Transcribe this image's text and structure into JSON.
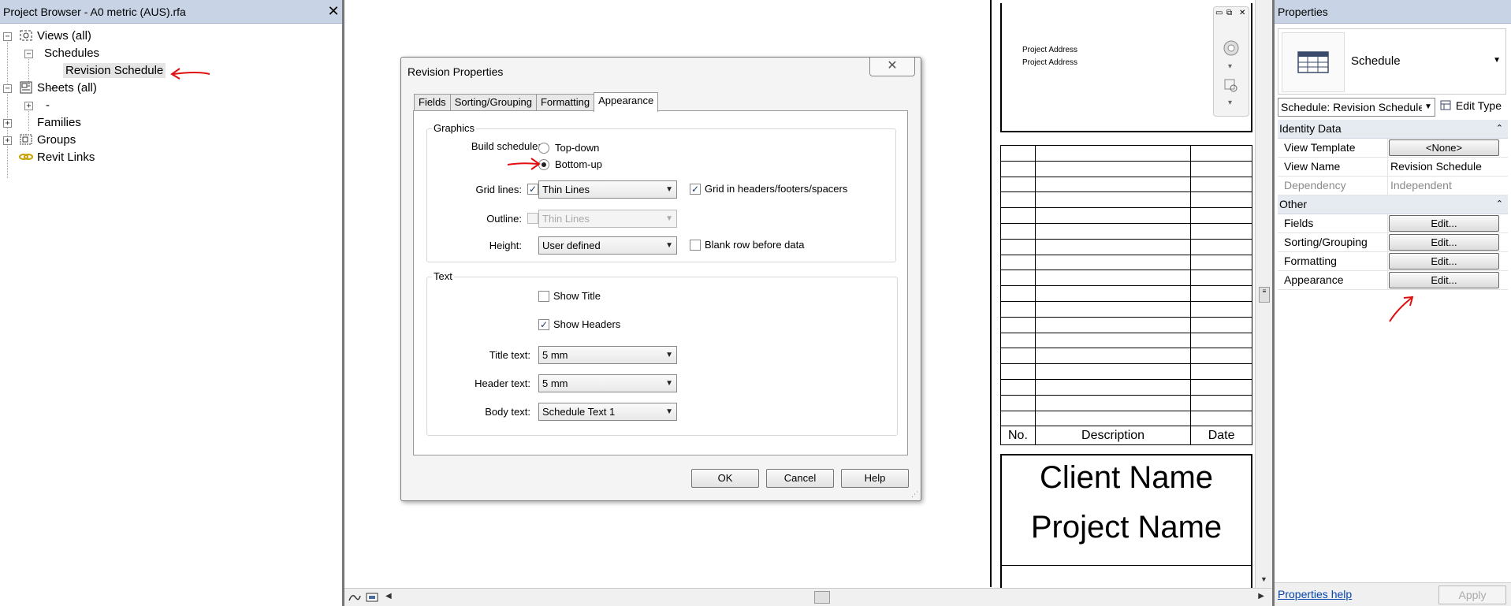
{
  "project_browser": {
    "title": "Project Browser - A0 metric (AUS).rfa",
    "close": "✕",
    "nodes": {
      "views": "Views (all)",
      "schedules": "Schedules",
      "revision_schedule": "Revision Schedule",
      "sheets": "Sheets (all)",
      "sheet_child": "-",
      "families": "Families",
      "groups": "Groups",
      "revit_links": "Revit Links"
    }
  },
  "titleblock": {
    "address_line1": "Project Address",
    "address_line2": "Project Address",
    "table_headers": [
      "No.",
      "Description",
      "Date"
    ],
    "client_name": "Client Name",
    "project_name": "Project Name"
  },
  "dialog": {
    "title": "Revision Properties",
    "close": "✕",
    "tabs": [
      "Fields",
      "Sorting/Grouping",
      "Formatting",
      "Appearance"
    ],
    "active_tab": "Appearance",
    "graphics": {
      "group_label": "Graphics",
      "build_schedule_label": "Build schedule:",
      "top_down": "Top-down",
      "bottom_up": "Bottom-up",
      "selected": "Bottom-up",
      "grid_lines_label": "Grid lines:",
      "grid_lines_checked": true,
      "grid_lines_value": "Thin Lines",
      "grid_in_headers": "Grid in headers/footers/spacers",
      "grid_in_headers_checked": true,
      "outline_label": "Outline:",
      "outline_checked": false,
      "outline_value": "Thin Lines",
      "height_label": "Height:",
      "height_value": "User defined",
      "blank_row": "Blank row before data",
      "blank_row_checked": false
    },
    "text": {
      "group_label": "Text",
      "show_title": "Show Title",
      "show_title_checked": false,
      "show_headers": "Show Headers",
      "show_headers_checked": true,
      "title_text_label": "Title text:",
      "title_text_value": "5 mm",
      "header_text_label": "Header text:",
      "header_text_value": "5 mm",
      "body_text_label": "Body text:",
      "body_text_value": "Schedule Text 1"
    },
    "buttons": {
      "ok": "OK",
      "cancel": "Cancel",
      "help": "Help"
    }
  },
  "properties": {
    "title": "Properties",
    "type_name": "Schedule",
    "selector": "Schedule: Revision Schedule",
    "edit_type": "Edit Type",
    "sections": {
      "identity": "Identity Data",
      "other": "Other"
    },
    "identity_rows": [
      {
        "name": "View Template",
        "value": "<None>",
        "button": true
      },
      {
        "name": "View Name",
        "value": "Revision Schedule",
        "button": false
      },
      {
        "name": "Dependency",
        "value": "Independent",
        "button": false
      }
    ],
    "other_rows": [
      {
        "name": "Fields",
        "value": "Edit..."
      },
      {
        "name": "Sorting/Grouping",
        "value": "Edit..."
      },
      {
        "name": "Formatting",
        "value": "Edit..."
      },
      {
        "name": "Appearance",
        "value": "Edit..."
      }
    ],
    "help_link": "Properties help",
    "apply": "Apply"
  },
  "colors": {
    "panel_title_bg": "#c8d4e6",
    "annotation_red": "#e01010",
    "section_bg": "#e6ebf2"
  }
}
